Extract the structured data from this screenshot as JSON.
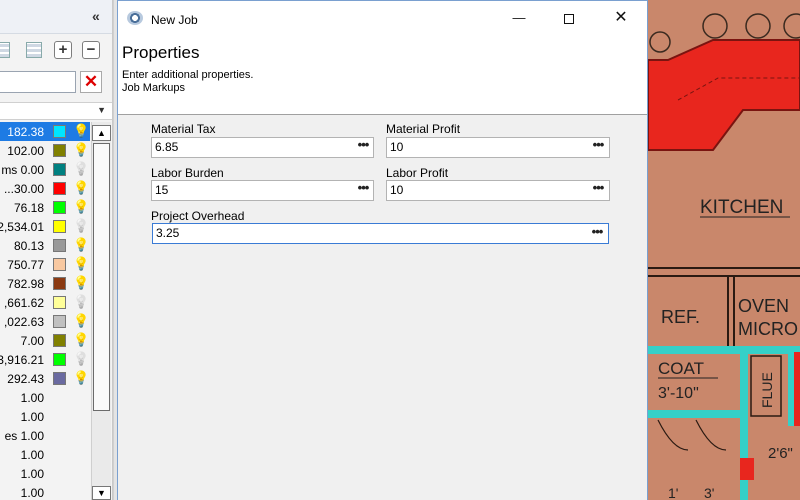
{
  "left_panel": {
    "collapse_glyph": "«",
    "toolbar": {
      "add_label": "+",
      "remove_label": "−"
    },
    "search": {
      "value": "",
      "clear_label": "✕"
    },
    "rows": [
      {
        "value": "182.38",
        "color": "#00e5ff",
        "bulb": "on",
        "selected": true
      },
      {
        "value": "102.00",
        "color": "#808000",
        "bulb": "on"
      },
      {
        "value": "ms 0.00",
        "color": "#008080",
        "bulb": "off"
      },
      {
        "value": "...30.00",
        "color": "#ff0000",
        "bulb": "on"
      },
      {
        "value": "76.18",
        "color": "#00ff00",
        "bulb": "on"
      },
      {
        "value": "2,534.01",
        "color": "#ffff00",
        "bulb": "off"
      },
      {
        "value": "80.13",
        "color": "#999999",
        "bulb": "on"
      },
      {
        "value": "750.77",
        "color": "#f8c8a0",
        "bulb": "on"
      },
      {
        "value": "782.98",
        "color": "#8b3a12",
        "bulb": "on"
      },
      {
        "value": ",661.62",
        "color": "#ffff99",
        "bulb": "off"
      },
      {
        "value": ",022.63",
        "color": "#c0c0c0",
        "bulb": "on"
      },
      {
        "value": "7.00",
        "color": "#808000",
        "bulb": "on"
      },
      {
        "value": "3,916.21",
        "color": "#00ff00",
        "bulb": "off"
      },
      {
        "value": "292.43",
        "color": "#6a6aa0",
        "bulb": "on"
      },
      {
        "value": "1.00"
      },
      {
        "value": "1.00"
      },
      {
        "value": "es 1.00"
      },
      {
        "value": "1.00"
      },
      {
        "value": "1.00"
      },
      {
        "value": "1.00"
      }
    ]
  },
  "dialog": {
    "title": "New Job",
    "window_buttons": {
      "minimize": "—",
      "close": "✕"
    },
    "header": {
      "title": "Properties",
      "subtitle": "Enter additional properties.",
      "section": "Job Markups"
    },
    "fields": {
      "material_tax": {
        "label": "Material Tax",
        "value": "6.85"
      },
      "material_profit": {
        "label": "Material Profit",
        "value": "10"
      },
      "labor_burden": {
        "label": "Labor Burden",
        "value": "15"
      },
      "labor_profit": {
        "label": "Labor Profit",
        "value": "10"
      },
      "project_overhead": {
        "label": "Project Overhead",
        "value": "3.25"
      }
    },
    "ellipsis": "•••"
  },
  "floorplan": {
    "labels": {
      "kitchen": "KITCHEN",
      "ref": "REF.",
      "oven": "OVEN",
      "micro": "MICRO",
      "coat": "COAT",
      "coat_dim": "3'-10\"",
      "flue": "FLUE",
      "dim_1": "2'6\"",
      "dim_2": "1'",
      "dim_3": "3'"
    }
  }
}
